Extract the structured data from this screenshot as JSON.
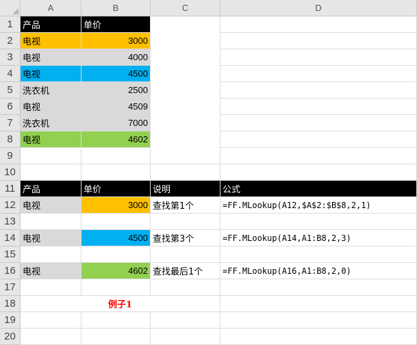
{
  "columns": [
    "A",
    "B",
    "C",
    "D"
  ],
  "rows": [
    "1",
    "2",
    "3",
    "4",
    "5",
    "6",
    "7",
    "8",
    "9",
    "10",
    "11",
    "12",
    "13",
    "14",
    "15",
    "16",
    "17",
    "18",
    "19",
    "20"
  ],
  "table1": {
    "header": [
      "产品",
      "单价"
    ],
    "data": [
      {
        "product": "电视",
        "price": "3000"
      },
      {
        "product": "电视",
        "price": "4000"
      },
      {
        "product": "电视",
        "price": "4500"
      },
      {
        "product": "洗衣机",
        "price": "2500"
      },
      {
        "product": "电视",
        "price": "4509"
      },
      {
        "product": "洗衣机",
        "price": "7000"
      },
      {
        "product": "电视",
        "price": "4602"
      }
    ]
  },
  "table2": {
    "header": [
      "产品",
      "单价",
      "说明",
      "公式"
    ],
    "rows": [
      {
        "product": "电视",
        "price": "3000",
        "desc": "查找第1个",
        "formula": "=FF.MLookup(A12,$A$2:$B$8,2,1)"
      },
      {
        "product": "电视",
        "price": "4500",
        "desc": "查找第3个",
        "formula": "=FF.MLookup(A14,A1:B8,2,3)"
      },
      {
        "product": "电视",
        "price": "4602",
        "desc": "查找最后1个",
        "formula": "=FF.MLookup(A16,A1:B8,2,0)"
      }
    ]
  },
  "example_label": "例子1",
  "colors": {
    "header": "#000000",
    "gray": "#d9d9d9",
    "orange": "#ffc000",
    "blue": "#00b0f0",
    "green": "#92d050",
    "example_text": "#ff0000"
  }
}
